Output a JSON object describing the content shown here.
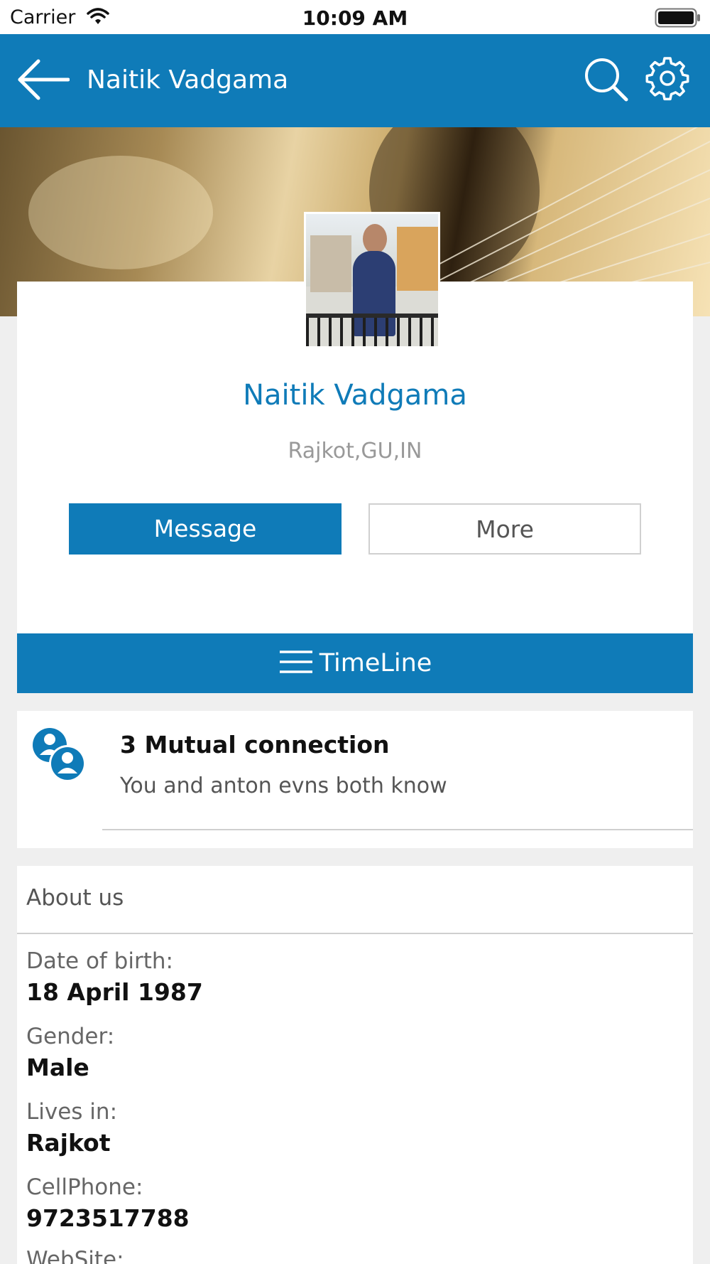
{
  "status_bar": {
    "carrier": "Carrier",
    "time": "10:09 AM"
  },
  "app_bar": {
    "title": "Naitik Vadgama"
  },
  "profile": {
    "name": "Naitik Vadgama",
    "location": "Rajkot,GU,IN",
    "message_button": "Message",
    "more_button": "More"
  },
  "timeline": {
    "label": "TimeLine"
  },
  "mutual": {
    "title": "3 Mutual connection",
    "subtitle": "You and anton evns both know"
  },
  "about": {
    "header": "About us",
    "fields": [
      {
        "label": "Date of birth:",
        "value": "18 April 1987"
      },
      {
        "label": "Gender:",
        "value": "Male"
      },
      {
        "label": "Lives in:",
        "value": "Rajkot"
      },
      {
        "label": "CellPhone:",
        "value": "9723517788"
      },
      {
        "label": "WebSite:",
        "value": ""
      }
    ]
  },
  "colors": {
    "brand_blue": "#0f7bb8",
    "background": "#efefef"
  },
  "icons": [
    "wifi-icon",
    "battery-icon",
    "back-arrow-icon",
    "search-icon",
    "gear-icon",
    "menu-icon",
    "people-icon"
  ]
}
